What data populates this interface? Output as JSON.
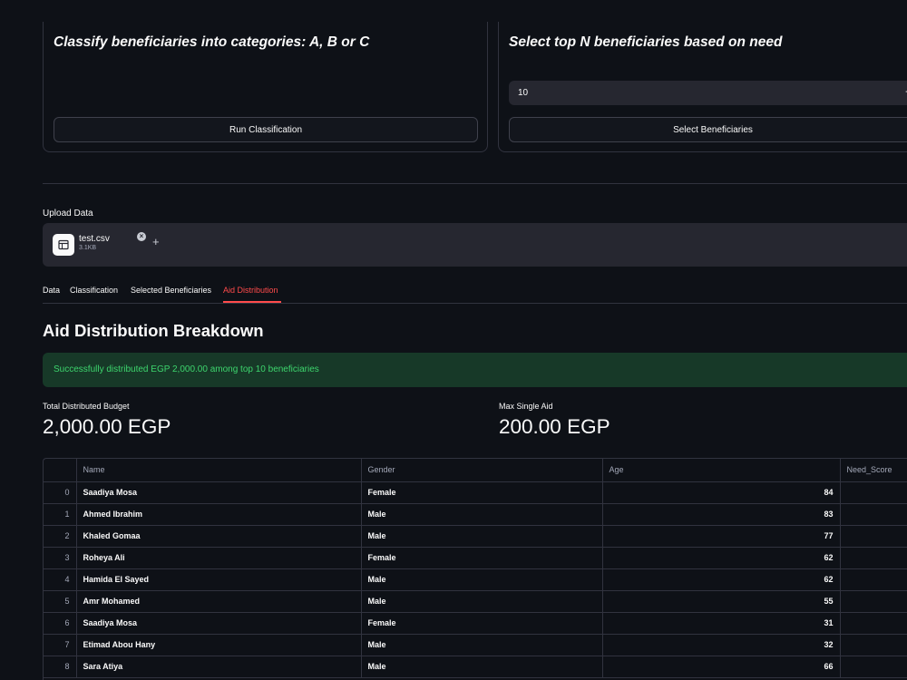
{
  "classification": {
    "title": "Classify beneficiaries into categories: A, B or C",
    "button_label": "Run Classification"
  },
  "selection": {
    "title": "Select top N beneficiaries based on need",
    "n_value": "10",
    "minus_label": "−",
    "button_label": "Select Beneficiaries"
  },
  "upload": {
    "label": "Upload Data",
    "file_name": "test.csv",
    "file_size": "3.1KB",
    "icon": "file-table-icon"
  },
  "tabs": [
    {
      "label": "Data"
    },
    {
      "label": "Classification"
    },
    {
      "label": "Selected Beneficiaries"
    },
    {
      "label": "Aid Distribution"
    }
  ],
  "active_tab": "Aid Distribution",
  "section": {
    "title": "Aid Distribution Breakdown"
  },
  "alert": {
    "text": "Successfully distributed EGP 2,000.00 among top 10 beneficiaries"
  },
  "metrics": {
    "total": {
      "label": "Total Distributed Budget",
      "value": "2,000.00 EGP"
    },
    "max": {
      "label": "Max Single Aid",
      "value": "200.00 EGP"
    }
  },
  "table": {
    "columns": [
      "",
      "Name",
      "Gender",
      "Age",
      "Need_Score"
    ],
    "rows": [
      {
        "index": "0",
        "name": "Saadiya Mosa",
        "gender": "Female",
        "age": "84"
      },
      {
        "index": "1",
        "name": "Ahmed Ibrahim",
        "gender": "Male",
        "age": "83"
      },
      {
        "index": "2",
        "name": "Khaled Gomaa",
        "gender": "Male",
        "age": "77"
      },
      {
        "index": "3",
        "name": "Roheya Ali",
        "gender": "Female",
        "age": "62"
      },
      {
        "index": "4",
        "name": "Hamida El Sayed",
        "gender": "Male",
        "age": "62"
      },
      {
        "index": "5",
        "name": "Amr Mohamed",
        "gender": "Male",
        "age": "55"
      },
      {
        "index": "6",
        "name": "Saadiya Mosa",
        "gender": "Female",
        "age": "31"
      },
      {
        "index": "7",
        "name": "Etimad Abou Hany",
        "gender": "Male",
        "age": "32"
      },
      {
        "index": "8",
        "name": "Sara Atiya",
        "gender": "Male",
        "age": "66"
      }
    ]
  },
  "colors": {
    "background": "#0e1117",
    "accent": "#ff4b4b",
    "success_bg": "#173928",
    "success_text": "#3dd56d"
  }
}
